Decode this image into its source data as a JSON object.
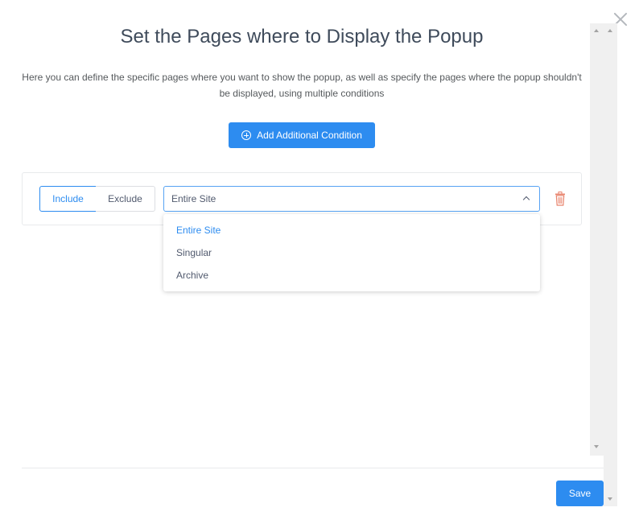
{
  "header": {
    "title": "Set the Pages where to Display the Popup",
    "description": "Here you can define the specific pages where you want to show the popup, as well as specify the pages where the popup shouldn't be displayed, using multiple conditions"
  },
  "toolbar": {
    "add_condition_label": "Add Additional Condition",
    "add_condition_icon": "plus-circle-icon"
  },
  "condition": {
    "mode_include_label": "Include",
    "mode_exclude_label": "Exclude",
    "mode_selected": "Include",
    "selected_value": "Entire Site",
    "options": [
      "Entire Site",
      "Singular",
      "Archive"
    ],
    "delete_icon": "trash-icon"
  },
  "footer": {
    "save_label": "Save"
  },
  "colors": {
    "accent": "#2d8cf0",
    "danger_icon": "#e8836c",
    "close_icon": "#b4b8bd"
  }
}
